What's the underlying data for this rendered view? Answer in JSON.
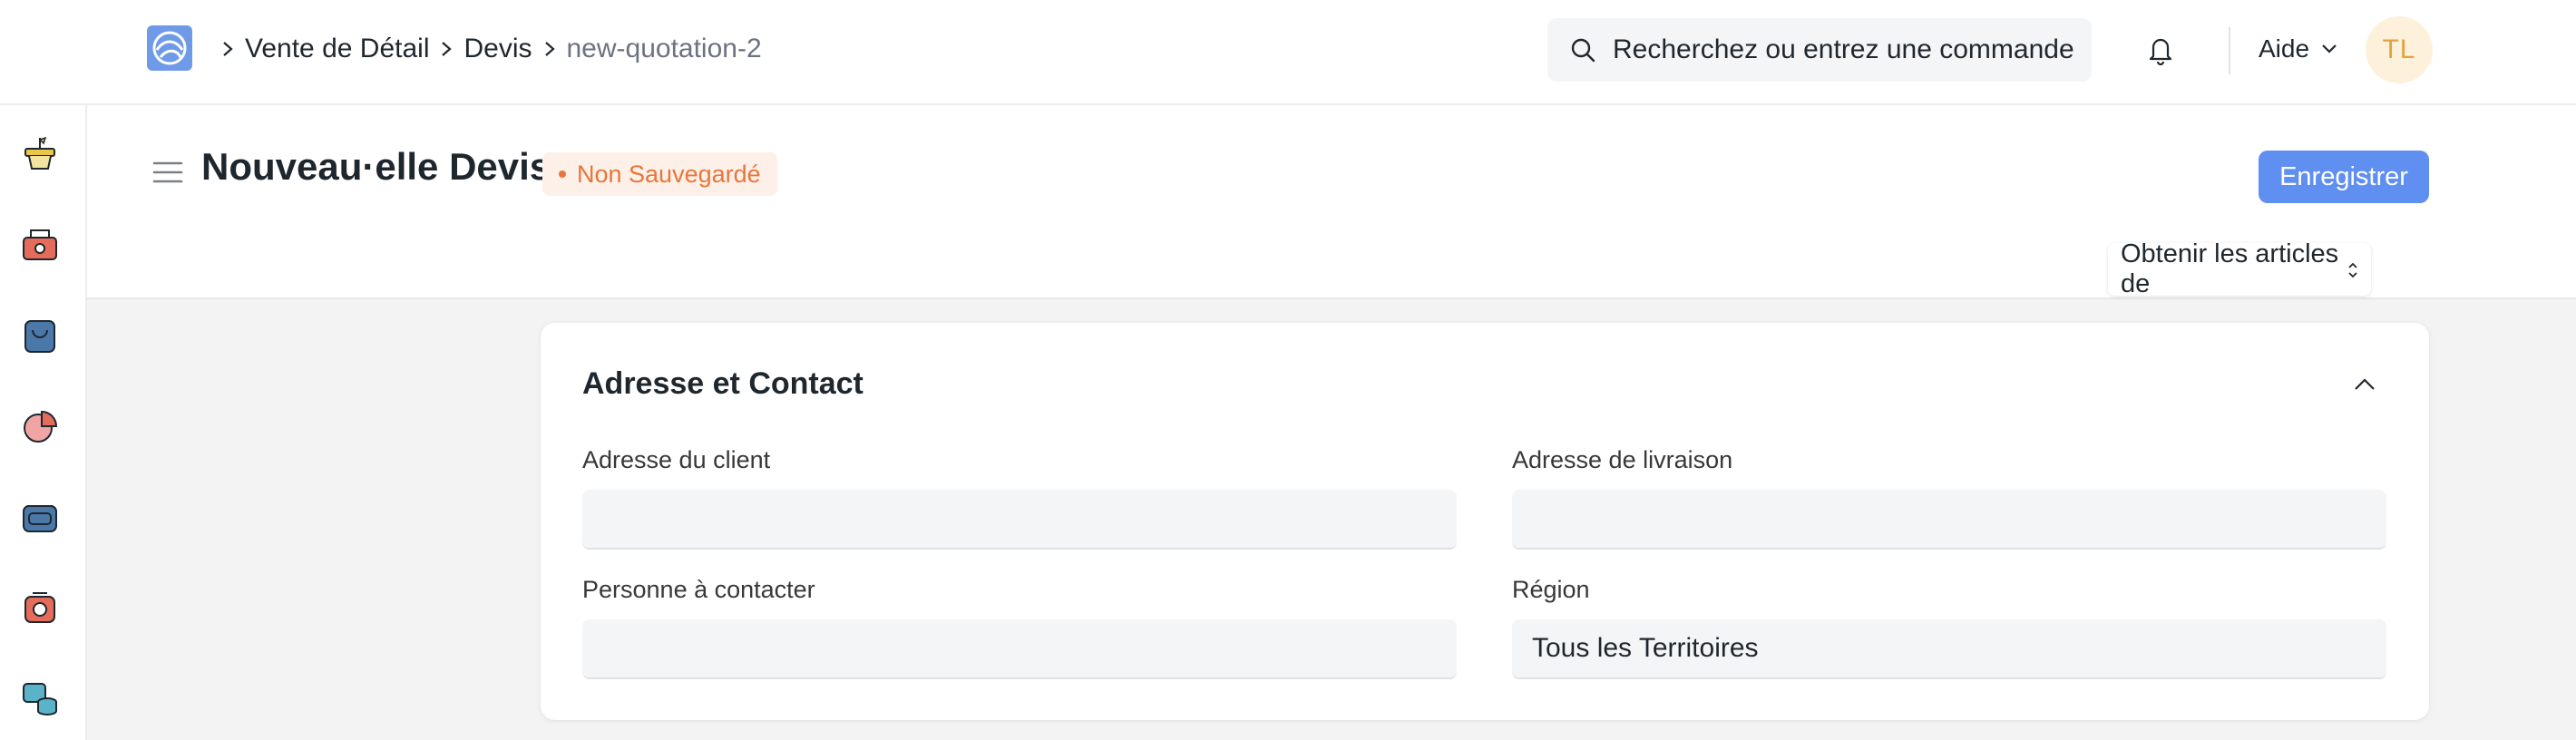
{
  "navbar": {
    "logo_icon": "frappe-logo-icon",
    "breadcrumbs": [
      "Vente de Détail",
      "Devis",
      "new-quotation-2"
    ],
    "search_placeholder": "Recherchez ou entrez une commande",
    "help_label": "Aide",
    "avatar_initials": "TL"
  },
  "sidebar": {
    "icons": [
      "retail-icon",
      "pos-icon",
      "shopping-bag-icon",
      "pie-chart-icon",
      "projects-icon",
      "support-icon",
      "assets-icon"
    ]
  },
  "page": {
    "title": "Nouveau·elle Devis",
    "status": "Non Sauvegardé",
    "save_label": "Enregistrer",
    "get_items_label": "Obtenir les articles de"
  },
  "section": {
    "title": "Adresse et Contact",
    "fields": {
      "customer_address": {
        "label": "Adresse du client",
        "value": ""
      },
      "shipping_address": {
        "label": "Adresse de livraison",
        "value": ""
      },
      "contact_person": {
        "label": "Personne à contacter",
        "value": ""
      },
      "territory": {
        "label": "Région",
        "value": "Tous les Territoires"
      }
    }
  },
  "colors": {
    "primary": "#5f8ff0",
    "status_text": "#e8763a",
    "status_bg": "#fdf0e8",
    "avatar_bg": "#fdf1dc",
    "avatar_text": "#e0a33d"
  }
}
